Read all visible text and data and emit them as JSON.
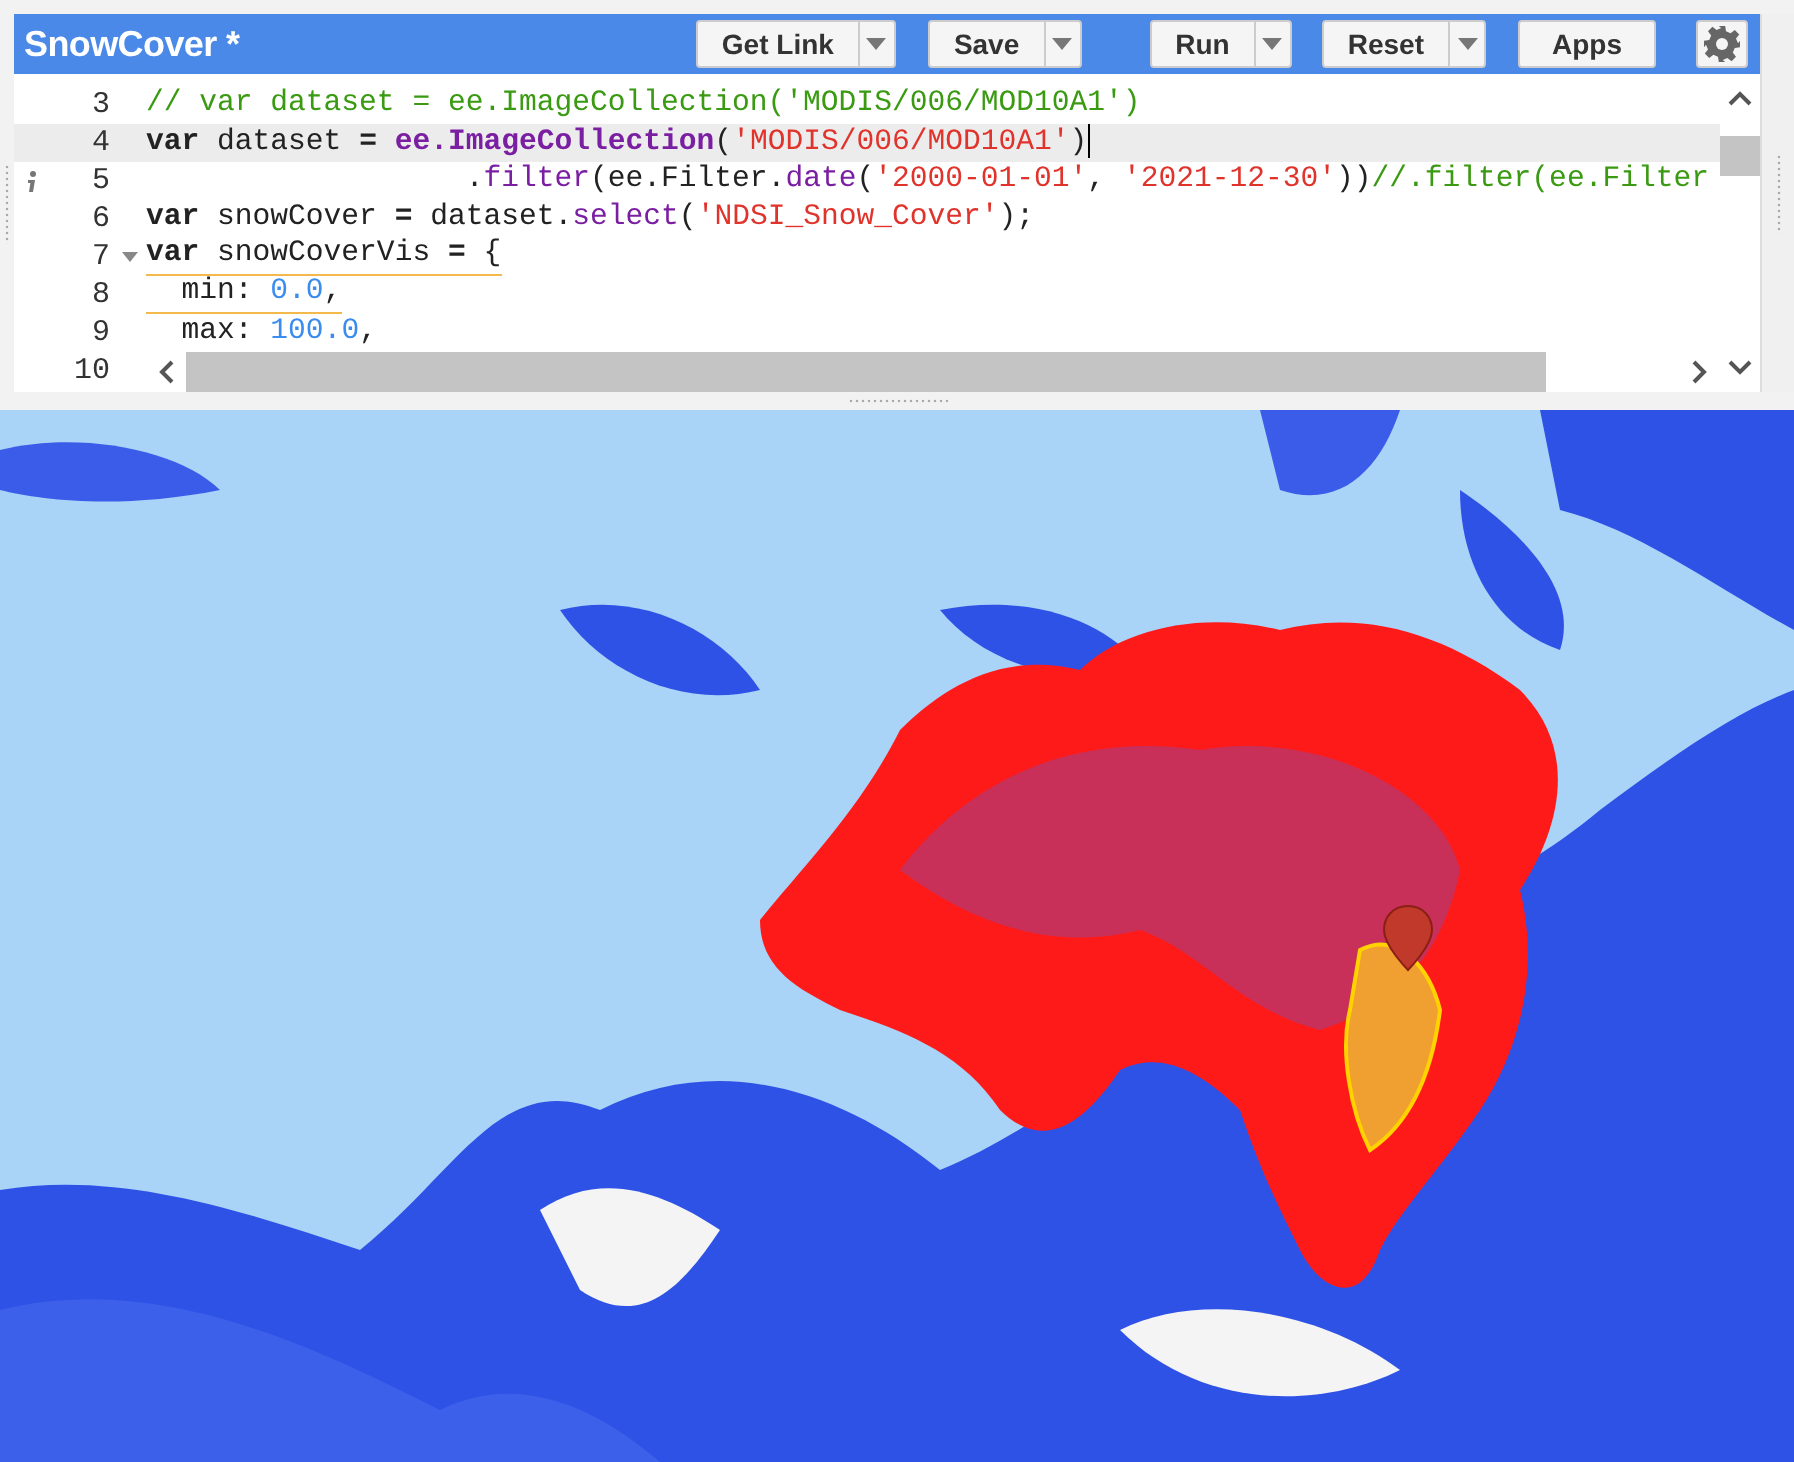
{
  "header": {
    "title": "SnowCover *"
  },
  "toolbar": [
    {
      "label": "Get Link",
      "dropdown": true
    },
    {
      "label": "Save",
      "dropdown": true
    },
    {
      "label": "Run",
      "dropdown": true
    },
    {
      "label": "Reset",
      "dropdown": true
    },
    {
      "label": "Apps",
      "dropdown": false
    }
  ],
  "editor": {
    "lines": [
      {
        "number": "3",
        "current": false,
        "info": false,
        "foldable": false,
        "warning": false,
        "segments": [
          {
            "kind": "comment",
            "text": "// var dataset = ee.ImageCollection('MODIS/006/MOD10A1')"
          }
        ]
      },
      {
        "number": "4",
        "current": true,
        "info": false,
        "foldable": false,
        "warning": false,
        "segments": [
          {
            "kind": "keyword",
            "text": "var"
          },
          {
            "kind": "plain",
            "text": " dataset "
          },
          {
            "kind": "keyword",
            "text": "= "
          },
          {
            "kind": "function",
            "text": "ee.ImageCollection"
          },
          {
            "kind": "plain",
            "text": "("
          },
          {
            "kind": "string",
            "text": "'MODIS/006/MOD10A1'"
          },
          {
            "kind": "plain",
            "text": ")"
          }
        ]
      },
      {
        "number": "5",
        "current": false,
        "info": true,
        "foldable": false,
        "warning": false,
        "segments": [
          {
            "kind": "plain",
            "text": "                  ."
          },
          {
            "kind": "function",
            "text": "filter"
          },
          {
            "kind": "plain",
            "text": "(ee.Filter."
          },
          {
            "kind": "function",
            "text": "date"
          },
          {
            "kind": "plain",
            "text": "("
          },
          {
            "kind": "string",
            "text": "'2000-01-01'"
          },
          {
            "kind": "plain",
            "text": ", "
          },
          {
            "kind": "string",
            "text": "'2021-12-30'"
          },
          {
            "kind": "plain",
            "text": "))"
          },
          {
            "kind": "comment",
            "text": "//.filter(ee.Filter"
          }
        ]
      },
      {
        "number": "6",
        "current": false,
        "info": false,
        "foldable": false,
        "warning": false,
        "segments": [
          {
            "kind": "keyword",
            "text": "var"
          },
          {
            "kind": "plain",
            "text": " snowCover "
          },
          {
            "kind": "keyword",
            "text": "="
          },
          {
            "kind": "plain",
            "text": " dataset."
          },
          {
            "kind": "function",
            "text": "select"
          },
          {
            "kind": "plain",
            "text": "("
          },
          {
            "kind": "string",
            "text": "'NDSI_Snow_Cover'"
          },
          {
            "kind": "plain",
            "text": ");"
          }
        ]
      },
      {
        "number": "7",
        "current": false,
        "info": false,
        "foldable": true,
        "warning": true,
        "segments": [
          {
            "kind": "keyword",
            "text": "var"
          },
          {
            "kind": "plain",
            "text": " snowCoverVis "
          },
          {
            "kind": "keyword",
            "text": "="
          },
          {
            "kind": "plain",
            "text": " {"
          }
        ]
      },
      {
        "number": "8",
        "current": false,
        "info": false,
        "foldable": false,
        "warning": true,
        "segments": [
          {
            "kind": "plain",
            "text": "  min: "
          },
          {
            "kind": "number",
            "text": "0.0"
          },
          {
            "kind": "plain",
            "text": ","
          }
        ]
      },
      {
        "number": "9",
        "current": false,
        "info": false,
        "foldable": false,
        "warning": false,
        "segments": [
          {
            "kind": "plain",
            "text": "  max: "
          },
          {
            "kind": "number",
            "text": "100.0"
          },
          {
            "kind": "plain",
            "text": ","
          }
        ]
      },
      {
        "number": "10",
        "current": false,
        "info": false,
        "foldable": false,
        "warning": false
      }
    ]
  }
}
